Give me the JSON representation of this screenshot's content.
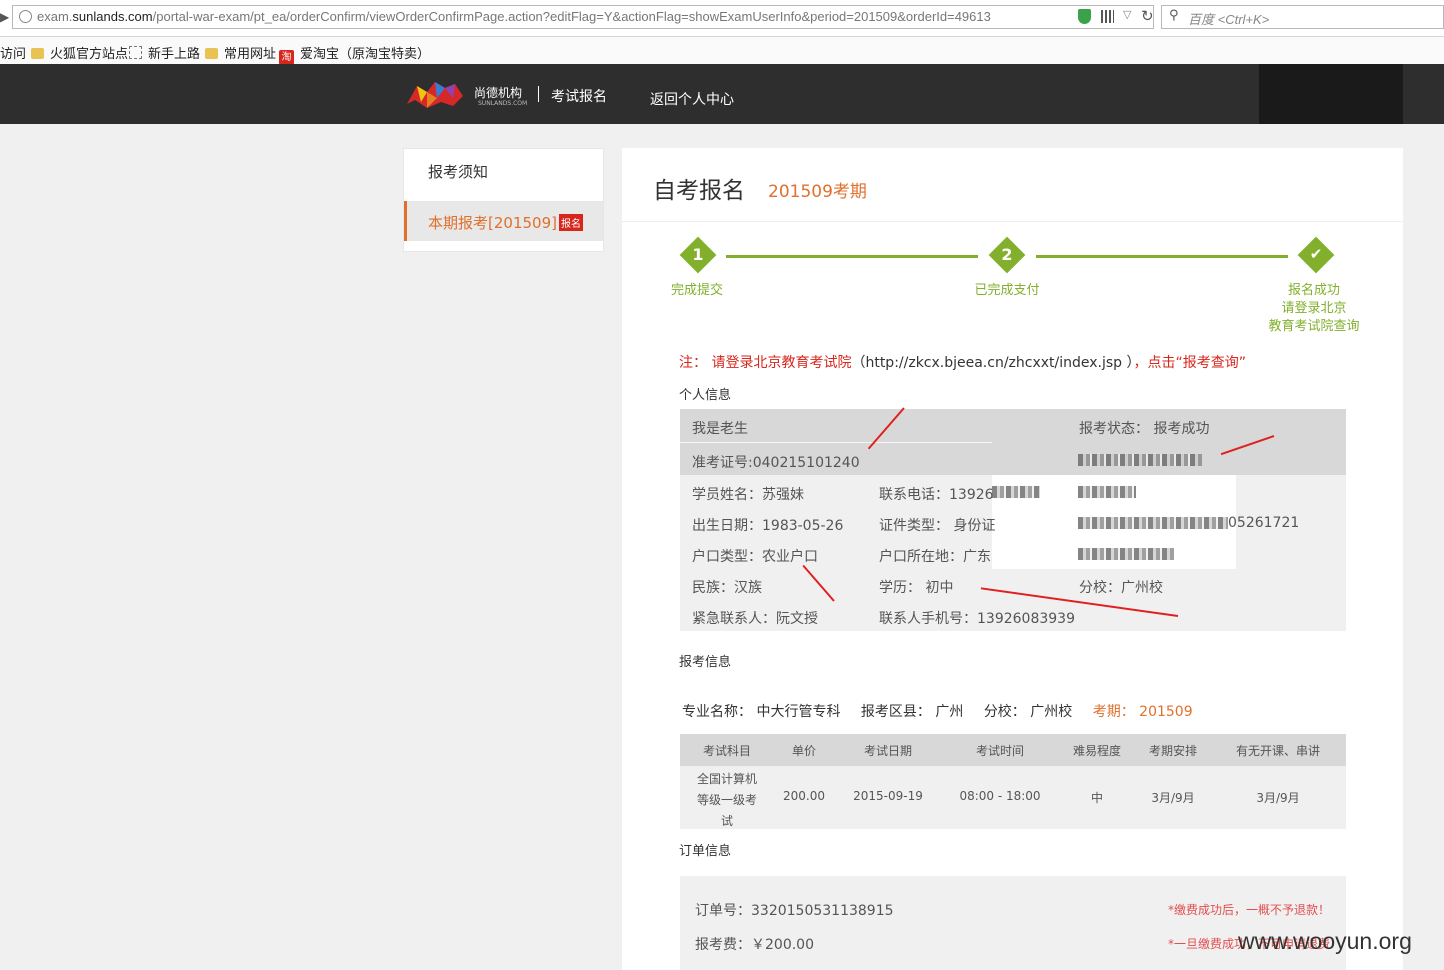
{
  "browser": {
    "url_prefix": "exam.",
    "url_domain": "sunlands.com",
    "url_path": "/portal-war-exam/pt_ea/orderConfirm/viewOrderConfirmPage.action?editFlag=Y&actionFlag=showExamUserInfo&period=201509&orderId=49613",
    "search_placeholder": "百度 <Ctrl+K>"
  },
  "bookmarks": [
    "访问",
    "火狐官方站点",
    "新手上路",
    "常用网址",
    "爱淘宝（原淘宝特卖）"
  ],
  "header": {
    "logo_text": "尚德机构",
    "logo_sub": "SUNLANDS.COM",
    "nav_exam": "考试报名",
    "nav_back": "返回个人中心"
  },
  "sidebar": {
    "item1": "报考须知",
    "item2": "本期报考[201509]",
    "item2_badge": "报名"
  },
  "page": {
    "title": "自考报名",
    "period": "201509考期"
  },
  "steps": [
    {
      "num": "1",
      "label": "完成提交"
    },
    {
      "num": "2",
      "label": "已完成支付"
    },
    {
      "num": "✔",
      "label": "报名成功",
      "sub1": "请登录北京",
      "sub2": "教育考试院查询"
    }
  ],
  "note": {
    "part1": "注： 请登录北京教育考试院",
    "part2": "（http://zkcx.bjeea.cn/zhcxxt/index.jsp ）",
    "part3": "，点击“报考查询”"
  },
  "personal": {
    "section": "个人信息",
    "name_line": "我是老生",
    "status": "报考状态： 报考成功",
    "ticket": "准考证号:040215101240",
    "student_name": "学员姓名：苏强妹",
    "phone": "联系电话：13926",
    "birth": "出生日期：1983-05-26",
    "id_type": "证件类型： 身份证",
    "id_tail": "05261721",
    "hukou_type": "户口类型：农业户口",
    "hukou_loc": "户口所在地：广东",
    "ethnic": "民族：汉族",
    "edu": "学历： 初中",
    "branch": "分校：广州校",
    "emergency": "紧急联系人：阮文授",
    "contact_phone": "联系人手机号：13926083939"
  },
  "exam": {
    "section": "报考信息",
    "major_label": "专业名称：",
    "major": "中大行管专科",
    "area_label": "报考区县：",
    "area": "广州",
    "branch_label": "分校：",
    "branch": "广州校",
    "period_label": "考期：",
    "period": "201509"
  },
  "table": {
    "headers": [
      "考试科目",
      "单价",
      "考试日期",
      "考试时间",
      "难易程度",
      "考期安排",
      "有无开课、串讲"
    ],
    "row": {
      "subject1": "全国计算机",
      "subject2": "等级一级考",
      "subject3": "试",
      "price": "200.00",
      "date": "2015-09-19",
      "time": "08:00 - 18:00",
      "level": "中",
      "arrange": "3月/9月",
      "lecture": "3月/9月"
    }
  },
  "order": {
    "section": "订单信息",
    "number": "订单号：3320150531138915",
    "fee": "报考费：￥200.00",
    "warn1": "*缴费成功后，一概不予退款！",
    "warn2": "*一旦缴费成功，不可申请退费"
  },
  "watermark": "www.wooyun.org",
  "colors": {
    "accent": "#e0702c",
    "green": "#82b02c",
    "red": "#d8261c",
    "header": "#2e2e2e"
  }
}
